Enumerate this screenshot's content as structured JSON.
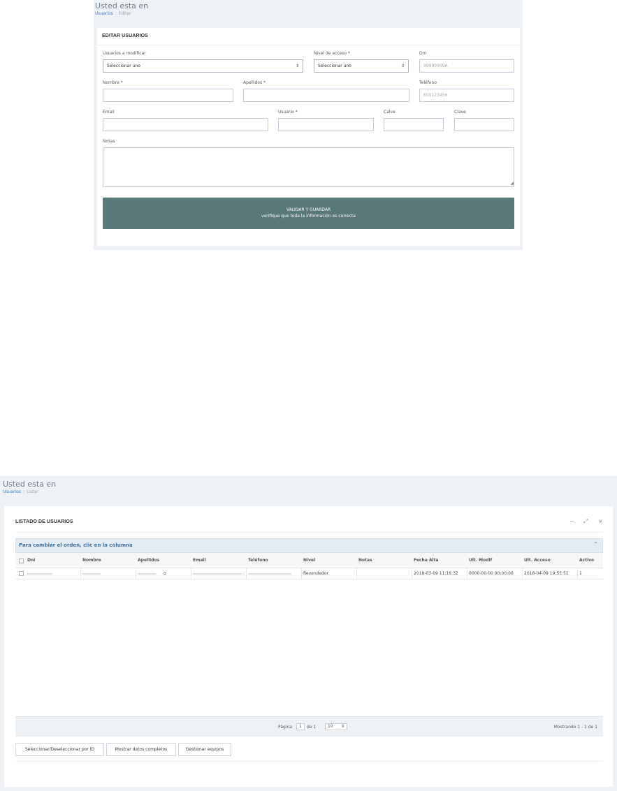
{
  "edit_view": {
    "page_title": "Usted esta en",
    "breadcrumb": {
      "parent": "Usuarios",
      "current": "Editar"
    },
    "panel_title": "EDITAR USUARIOS",
    "fields": {
      "usuarios_modificar": {
        "label": "Usuarios a modificar",
        "value": "Seleccionar uno"
      },
      "nivel_acceso": {
        "label": "Nivel de acceso *",
        "value": "Seleccionar uno"
      },
      "dni": {
        "label": "Dni",
        "placeholder": "99999999A"
      },
      "nombre": {
        "label": "Nombre *",
        "value": ""
      },
      "apellidos": {
        "label": "Apellidos *",
        "value": ""
      },
      "telefono": {
        "label": "Teléfono",
        "placeholder": "600123456"
      },
      "email": {
        "label": "Email",
        "value": ""
      },
      "usuario": {
        "label": "Usuario *",
        "value": ""
      },
      "calve": {
        "label": "Calve",
        "value": ""
      },
      "clave": {
        "label": "Clave",
        "value": ""
      },
      "notas": {
        "label": "Notas",
        "value": ""
      }
    },
    "submit": {
      "line1": "VALIDAR Y GUARDAR",
      "line2": "verifique que toda la información es correcta"
    }
  },
  "list_view": {
    "page_title": "Usted esta en",
    "breadcrumb": {
      "parent": "Usuarios",
      "current": "Listar"
    },
    "panel_title": "LISTADO DE USUARIOS",
    "tools": {
      "minimize": "−",
      "expand": "⤢",
      "close": "×"
    },
    "grid_caption": "Para cambiar el orden, clic en la columna",
    "columns": [
      "Dni",
      "Nombre",
      "Apellidos",
      "Email",
      "Teléfono",
      "Nivel",
      "Notas",
      "Fecha Alta",
      "Ult. Modif",
      "Ult. Acceso",
      "Activo"
    ],
    "rows": [
      {
        "dni": "",
        "nombre": "",
        "apellidos": "o",
        "email": ":",
        "telefono": "",
        "nivel": "Revendedor",
        "notas": "",
        "fecha_alta": "2018-03-09 11:16:32",
        "ult_modif": "0000-00-00 00:00:00",
        "ult_acceso": "2018-04-09 19:55:51",
        "activo": "1"
      }
    ],
    "pager": {
      "page_label": "Página",
      "page": "1",
      "of_label": "de 1",
      "page_size": "10",
      "summary": "Mostrando 1 - 1 de 1"
    },
    "buttons": {
      "select_by_id": "Seleccionar/Deseleccionar por ID",
      "show_full": "Mostrar datos completos",
      "manage_teams": "Gestionar equipos"
    }
  }
}
